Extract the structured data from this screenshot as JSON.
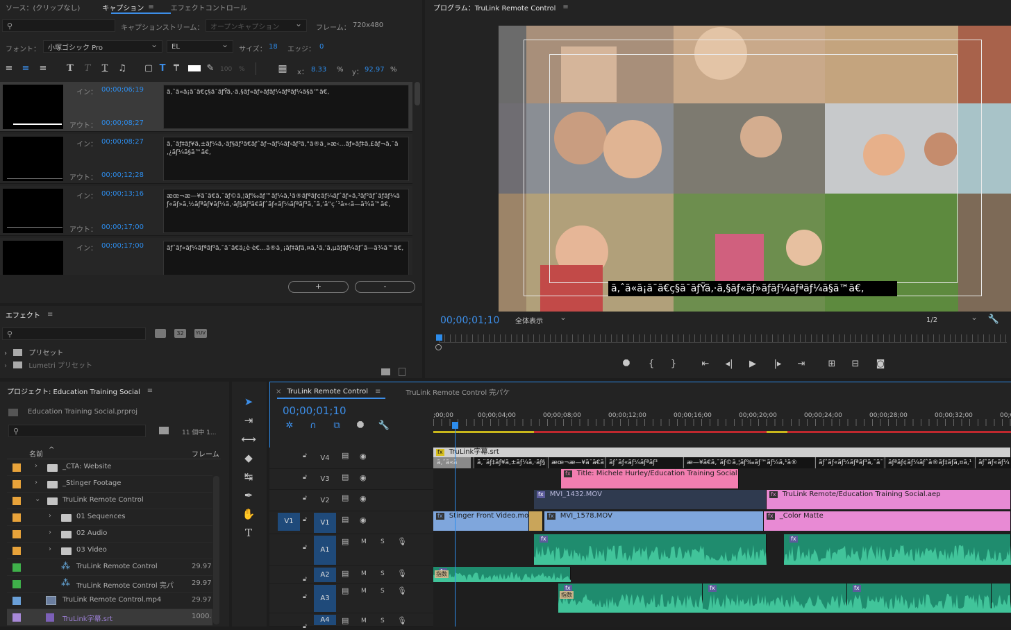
{
  "caption_panel": {
    "tabs": [
      "ソース：(クリップなし)",
      "キャプション",
      "エフェクトコントロール"
    ],
    "menu_icon": "≡",
    "caption_stream_label": "キャプションストリーム：",
    "caption_stream_value": "オープンキャプション",
    "frame_label": "フレーム：",
    "frame_value": "720x480",
    "font_label": "フォント：",
    "font_value": "小塚ゴシック Pro",
    "style_value": "EL",
    "size_label": "サイズ：",
    "size_value": "18",
    "edge_label": "エッジ：",
    "edge_value": "0",
    "opacity_value": "100",
    "opacity_unit": "%",
    "x_label": "x：",
    "x_value": "8.33",
    "y_label": "y：",
    "y_value": "92.97",
    "pct": "%",
    "in_label": "イン：",
    "out_label": "アウト：",
    "rows": [
      {
        "in": "00;00;06;19",
        "out": "00;00;08;27",
        "text": "ã‚ˆã«ã¡ã¯ã€ç§ã¯ãƒŸã‚·ã‚§ãƒ«ãƒ»ãƒãƒ¼ãƒªãƒ¼ã§ã™ã€‚"
      },
      {
        "in": "00;00;08;27",
        "out": "00;00;12;28",
        "text": "ã‚¨ãƒ‡ãƒ¥ã‚±ãƒ¼ã‚·ãƒ§ãƒ³ã€ãƒˆãƒ¬ãƒ¼ãƒ‹ãƒ³ã‚°ã®ä¸»æ‹…ãƒ»ãƒ‡ã‚£ãƒ¬ã‚¯ã‚¿ãƒ¼ã§ã™ã€‚"
      },
      {
        "in": "00;00;13;16",
        "out": "00;00;17;00",
        "text": "æœ¬æ—¥ã¯ã€ã‚¯ãƒ©ã‚¦ãƒ‰ãƒ™ãƒ¼ã‚¹ã®ãƒªãƒ¢ãƒ¼ãƒˆãƒ»ã‚³ãƒ³ãƒˆãƒ­ãƒ¼ãƒ«ãƒ»ã‚½ãƒªãƒ¥ãƒ¼ã‚·ãƒ§ãƒ³ã€ãƒˆãƒ«ãƒ¼ãƒªãƒ³ã‚¯ã‚’ã”ç´¹ä»‹ã—ã¾ã™ã€‚"
      },
      {
        "in": "00;00;17;00",
        "out": "",
        "text": "ãƒˆãƒ«ãƒ¼ãƒªãƒ³ã‚¯ã¯ã€ä¿è­·è€…ã®ä¸¡ãƒ‡ãƒã‚¤ã‚¹ã‚’ã‚µãƒãƒ¼ãƒˆã—ã¾ã™ã€‚"
      }
    ],
    "add_button": "+",
    "remove_button": "-"
  },
  "effects_panel": {
    "title": "エフェクト",
    "menu_icon": "≡",
    "badge_32": "32",
    "badge_yuv": "YUV",
    "items": [
      "プリセット",
      "Lumetri プリセット"
    ]
  },
  "program_monitor": {
    "title": "プログラム：TruLink Remote Control",
    "menu_icon": "≡",
    "timecode": "00;00;01;10",
    "zoom_value": "全体表示",
    "resolution_value": "1/2",
    "caption_overlay": "ã‚ˆã«ã¡ã¯ã€ç§ã¯ãƒŸã‚·ã‚§ãƒ«ãƒ»ãƒãƒ¼ãƒªãƒ¼ã§ã™ã€‚"
  },
  "project_panel": {
    "title": "プロジェクト: Education Training Social",
    "menu_icon": "≡",
    "file": "Education Training Social.prproj",
    "count": "11 個中 1...",
    "col_name": "名前",
    "col_frame": "フレーム",
    "items": [
      {
        "name": "_CTA: Website",
        "color": "#e8a33a",
        "type": "folder",
        "indent": 0,
        "expand": "›",
        "rate": ""
      },
      {
        "name": "_Stinger Footage",
        "color": "#e8a33a",
        "type": "folder",
        "indent": 0,
        "expand": "›",
        "rate": ""
      },
      {
        "name": "TruLink Remote Control",
        "color": "#e8a33a",
        "type": "folder",
        "indent": 0,
        "expand": "⌄",
        "rate": ""
      },
      {
        "name": "01 Sequences",
        "color": "#e8a33a",
        "type": "folder",
        "indent": 1,
        "expand": "›",
        "rate": ""
      },
      {
        "name": "02 Audio",
        "color": "#e8a33a",
        "type": "folder",
        "indent": 1,
        "expand": "›",
        "rate": ""
      },
      {
        "name": "03 Video",
        "color": "#e8a33a",
        "type": "folder",
        "indent": 1,
        "expand": "›",
        "rate": ""
      },
      {
        "name": "TruLink Remote Control",
        "color": "#3fb04a",
        "type": "sequence",
        "indent": 1,
        "expand": "",
        "rate": "29.97"
      },
      {
        "name": "TruLink Remote Control 完パ",
        "color": "#3fb04a",
        "type": "sequence",
        "indent": 1,
        "expand": "",
        "rate": "29.97"
      },
      {
        "name": "TruLink Remote Control.mp4",
        "color": "#6aa0d8",
        "type": "video",
        "indent": 0,
        "expand": "",
        "rate": "29.97"
      },
      {
        "name": "TruLink字幕.srt",
        "color": "#a889d8",
        "type": "caption",
        "indent": 0,
        "expand": "",
        "rate": "1000."
      }
    ]
  },
  "timeline": {
    "tabs": [
      "TruLink Remote Control",
      "TruLink Remote Control 完パケ"
    ],
    "close": "×",
    "menu_icon": "≡",
    "timecode": "00;00;01;10",
    "ruler": [
      ";00;00",
      "00;00;04;00",
      "00;00;08;00",
      "00;00;12;00",
      "00;00;16;00",
      "00;00;20;00",
      "00;00;24;00",
      "00;00;28;00",
      "00;00;32;00",
      "00;0"
    ],
    "track_M": "M",
    "track_S": "S",
    "source_v1": "V1",
    "tracks": [
      {
        "id": "V4"
      },
      {
        "id": "V3"
      },
      {
        "id": "V2"
      },
      {
        "id": "V1"
      },
      {
        "id": "A1"
      },
      {
        "id": "A2"
      },
      {
        "id": "A3"
      },
      {
        "id": "A4"
      }
    ],
    "clips": {
      "caption_name": "TruLink字幕.srt",
      "caption_segments": [
        "ã‚ˆã«ã",
        "ã‚¨ãƒ‡ãƒ¥ã‚±ãƒ¼ã‚·ãƒ§",
        "æœ¬æ—¥ã¯ã€ã‚¯",
        "ãƒˆãƒ«ãƒ¼ãƒªãƒ³",
        "æ—¥ã€ã‚¯ãƒ©ã‚¦ãƒ‰ãƒ™ãƒ¼ã‚¹ã®",
        "ãƒˆãƒ«ãƒ¼ãƒªãƒ³ã‚¯ã¯",
        "ãƒªãƒ¢ãƒ¼ãƒˆã®ãƒ‡ãƒã‚¤ã‚¹",
        "ãƒˆãƒ«ãƒ¼"
      ],
      "title_clip": "Title: Michele Hurley/Education Training Social",
      "mvi_1432": "MVI_1432.MOV",
      "aep_clip": "TruLink Remote/Education Training Social.aep",
      "stinger": "Stinger Front Video.mov",
      "mvi_1578": "MVI_1578.MOV",
      "color_matte": "_Color Matte",
      "fx": "fx",
      "tag": "指数"
    }
  },
  "colors": {
    "accent": "#2d8ceb",
    "caption_clip": "#cfcfcf",
    "title_clip": "#f27eb0",
    "video_clip": "#7fa6dc",
    "aep_clip": "#e88ad4",
    "audio_clip": "#1f8c6e"
  }
}
